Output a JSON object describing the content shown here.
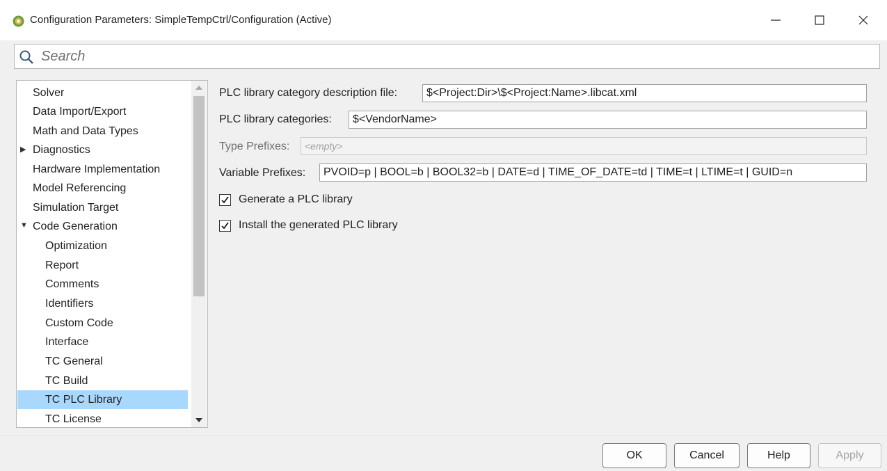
{
  "window": {
    "title": "Configuration Parameters: SimpleTempCtrl/Configuration (Active)",
    "app_icon": "matlab-config-icon",
    "controls": [
      "minimize-icon",
      "maximize-icon",
      "close-icon"
    ]
  },
  "search": {
    "placeholder": "Search",
    "icon": "search-icon"
  },
  "tree": {
    "items": [
      {
        "label": "Solver"
      },
      {
        "label": "Data Import/Export"
      },
      {
        "label": "Math and Data Types"
      },
      {
        "label": "Diagnostics",
        "expander": "▶"
      },
      {
        "label": "Hardware Implementation"
      },
      {
        "label": "Model Referencing"
      },
      {
        "label": "Simulation Target"
      },
      {
        "label": "Code Generation",
        "expander": "▼"
      },
      {
        "label": "Optimization"
      },
      {
        "label": "Report"
      },
      {
        "label": "Comments"
      },
      {
        "label": "Identifiers"
      },
      {
        "label": "Custom Code"
      },
      {
        "label": "Interface"
      },
      {
        "label": "TC General"
      },
      {
        "label": "TC Build"
      },
      {
        "label": "TC PLC Library",
        "selected": true
      },
      {
        "label": "TC License"
      }
    ]
  },
  "form": {
    "libcat_file": {
      "label": "PLC library category description file:",
      "value": "$<Project:Dir>\\$<Project:Name>.libcat.xml"
    },
    "categories": {
      "label": "PLC library categories:",
      "value": "$<VendorName>"
    },
    "type_prefixes": {
      "label": "Type Prefixes:",
      "placeholder": "<empty>"
    },
    "variable_prefixes": {
      "label": "Variable Prefixes:",
      "value": "PVOID=p | BOOL=b | BOOL32=b | DATE=d | TIME_OF_DATE=td | TIME=t | LTIME=t | GUID=n"
    },
    "generate_lib": {
      "label": "Generate a PLC library",
      "checked": true
    },
    "install_lib": {
      "label": "Install the generated PLC library",
      "checked": true
    }
  },
  "buttons": {
    "ok": "OK",
    "cancel": "Cancel",
    "help": "Help",
    "apply": "Apply"
  }
}
